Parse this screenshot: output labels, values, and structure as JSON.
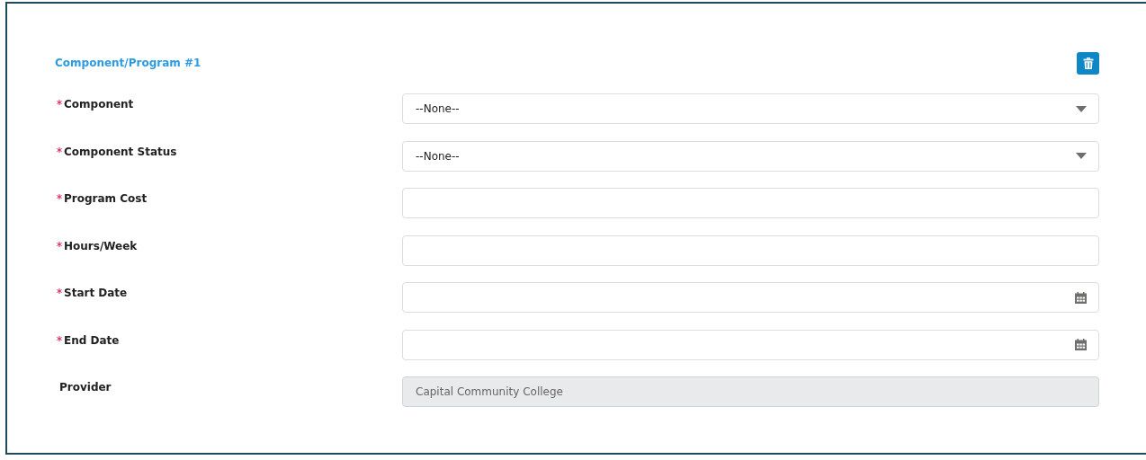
{
  "section": {
    "title": "Component/Program #1"
  },
  "fields": [
    {
      "label": "Component",
      "required": true,
      "kind": "select",
      "value": "--None--"
    },
    {
      "label": "Component Status",
      "required": true,
      "kind": "select",
      "value": "--None--"
    },
    {
      "label": "Program Cost",
      "required": true,
      "kind": "text"
    },
    {
      "label": "Hours/Week",
      "required": true,
      "kind": "text"
    },
    {
      "label": "Start Date",
      "required": true,
      "kind": "date"
    },
    {
      "label": "End Date",
      "required": true,
      "kind": "date"
    },
    {
      "label": "Provider",
      "required": false,
      "kind": "readonly",
      "value": "Capital Community College"
    }
  ]
}
